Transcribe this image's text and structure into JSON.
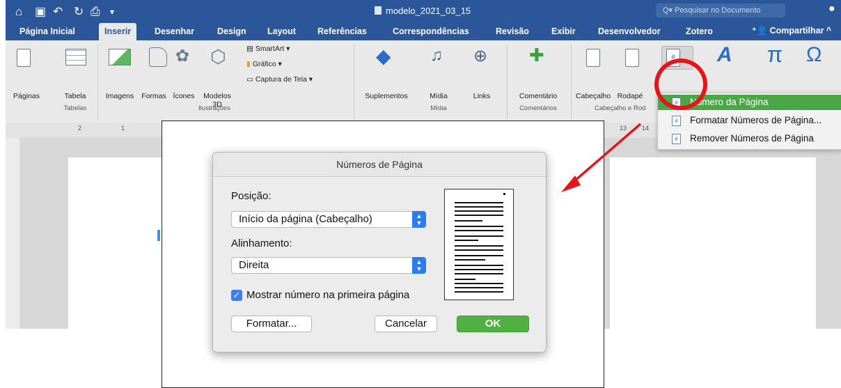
{
  "titlebar": {
    "doc_title": "modelo_2021_03_15",
    "search_placeholder": "Pesquisar no Documento"
  },
  "tabs": [
    "Página Inicial",
    "Inserir",
    "Desenhar",
    "Design",
    "Layout",
    "Referências",
    "Correspondências",
    "Revisão",
    "Exibir",
    "Desenvolvedor",
    "Zotero"
  ],
  "active_tab": "Inserir",
  "share_label": "Compartilhar",
  "ribbon": {
    "paginas": "Páginas",
    "tabela": "Tabela",
    "imagens": "Imagens",
    "formas": "Formas",
    "icones": "Ícones",
    "modelos_line1": "Modelos",
    "modelos_line2": "3D",
    "smartart": "SmartArt",
    "grafico": "Gráfico",
    "captura": "Captura de Tela",
    "suplementos": "Suplementos",
    "midia": "Mídia",
    "links": "Links",
    "comentario": "Comentário",
    "cabecalho": "Cabeçalho",
    "rodape": "Rodapé",
    "groups": {
      "tabelas": "Tabelas",
      "ilustracoes": "Ilustrações",
      "midia": "Mídia",
      "comentarios": "Comentários",
      "cabecalho_rodape": "Cabeçalho e Rod"
    }
  },
  "ruler_marks": [
    "2",
    "1",
    "13",
    "14"
  ],
  "menu": {
    "items": [
      "Número da Página",
      "Formatar Números de Página...",
      "Remover Números de Página"
    ],
    "highlighted_index": 0
  },
  "dialog": {
    "title": "Números de Página",
    "position_label": "Posição:",
    "position_value": "Início da página (Cabeçalho)",
    "alignment_label": "Alinhamento:",
    "alignment_value": "Direita",
    "checkbox_label": "Mostrar número na primeira página",
    "checkbox_checked": true,
    "format_button": "Formatar...",
    "cancel_button": "Cancelar",
    "ok_button": "OK"
  },
  "colors": {
    "word_blue": "#2b579a",
    "highlight_green": "#4aa746",
    "annotation_red": "#e8141b"
  }
}
